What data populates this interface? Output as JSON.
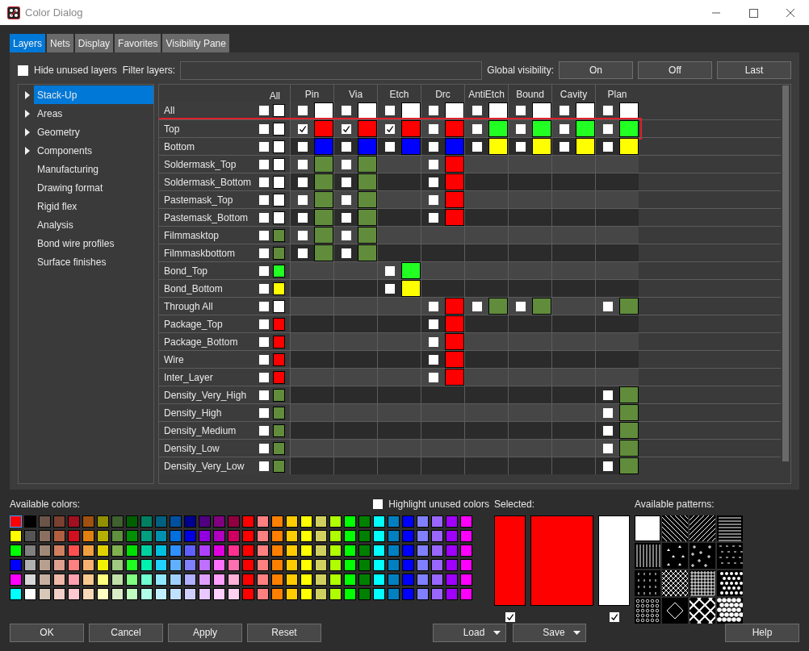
{
  "window": {
    "title": "Color Dialog"
  },
  "tabs": [
    {
      "label": "Layers",
      "selected": true
    },
    {
      "label": "Nets",
      "selected": false
    },
    {
      "label": "Display",
      "selected": false
    },
    {
      "label": "Favorites",
      "selected": false
    },
    {
      "label": "Visibility Pane",
      "selected": false
    }
  ],
  "filter_bar": {
    "hide_unused": {
      "label": "Hide unused layers",
      "checked": false
    },
    "filter_label": "Filter layers:",
    "global_label": "Global visibility:",
    "buttons": [
      "On",
      "Off",
      "Last"
    ]
  },
  "tree": [
    {
      "label": "Stack-Up",
      "kind": "group",
      "selected": true
    },
    {
      "label": "Areas",
      "kind": "group",
      "selected": false
    },
    {
      "label": "Geometry",
      "kind": "group",
      "selected": false
    },
    {
      "label": "Components",
      "kind": "group",
      "selected": false
    },
    {
      "label": "Manufacturing",
      "kind": "item",
      "selected": false
    },
    {
      "label": "Drawing format",
      "kind": "item",
      "selected": false
    },
    {
      "label": "Rigid flex",
      "kind": "item",
      "selected": false
    },
    {
      "label": "Analysis",
      "kind": "item",
      "selected": false
    },
    {
      "label": "Bond wire profiles",
      "kind": "item",
      "selected": false
    },
    {
      "label": "Surface finishes",
      "kind": "item",
      "selected": false
    }
  ],
  "table": {
    "columns": [
      "All",
      "Pin",
      "Via",
      "Etch",
      "Drc",
      "AntiEtch",
      "Bound",
      "Cavity",
      "Plan"
    ],
    "rows": [
      {
        "name": "All",
        "highlighted": false,
        "cells": [
          {
            "checked": false,
            "color": "#ffffff"
          },
          {
            "checked": false,
            "color": "#ffffff"
          },
          {
            "checked": false,
            "color": "#ffffff"
          },
          {
            "checked": false,
            "color": "#ffffff"
          },
          {
            "checked": false,
            "color": "#ffffff"
          },
          {
            "checked": false,
            "color": "#ffffff"
          },
          {
            "checked": false,
            "color": "#ffffff"
          },
          {
            "checked": false,
            "color": "#ffffff"
          },
          {
            "checked": false,
            "color": "#ffffff"
          }
        ]
      },
      {
        "name": "Top",
        "highlighted": true,
        "cells": [
          {
            "checked": false,
            "color": "#ffffff"
          },
          {
            "checked": true,
            "color": "#ff0000"
          },
          {
            "checked": true,
            "color": "#ff0000"
          },
          {
            "checked": true,
            "color": "#ff0000"
          },
          {
            "checked": false,
            "color": "#ff0000"
          },
          {
            "checked": false,
            "color": "#22ff22"
          },
          {
            "checked": false,
            "color": "#22ff22"
          },
          {
            "checked": false,
            "color": "#22ff22"
          },
          {
            "checked": false,
            "color": "#22ff22"
          }
        ]
      },
      {
        "name": "Bottom",
        "highlighted": false,
        "cells": [
          {
            "checked": false,
            "color": "#ffffff"
          },
          {
            "checked": false,
            "color": "#0000ff"
          },
          {
            "checked": false,
            "color": "#0000ff"
          },
          {
            "checked": false,
            "color": "#0000ff"
          },
          {
            "checked": false,
            "color": "#0000ff"
          },
          {
            "checked": false,
            "color": "#ffff00"
          },
          {
            "checked": false,
            "color": "#ffff00"
          },
          {
            "checked": false,
            "color": "#ffff00"
          },
          {
            "checked": false,
            "color": "#ffff00"
          }
        ]
      },
      {
        "name": "Soldermask_Top",
        "highlighted": false,
        "cells": [
          {
            "checked": false,
            "color": "#ffffff"
          },
          {
            "checked": false,
            "color": "#608c3c"
          },
          {
            "checked": false,
            "color": "#608c3c"
          },
          null,
          {
            "checked": false,
            "color": "#ff0000"
          },
          null,
          null,
          null,
          null
        ]
      },
      {
        "name": "Soldermask_Bottom",
        "highlighted": false,
        "cells": [
          {
            "checked": false,
            "color": "#ffffff"
          },
          {
            "checked": false,
            "color": "#608c3c"
          },
          {
            "checked": false,
            "color": "#608c3c"
          },
          null,
          {
            "checked": false,
            "color": "#ff0000"
          },
          null,
          null,
          null,
          null
        ]
      },
      {
        "name": "Pastemask_Top",
        "highlighted": false,
        "cells": [
          {
            "checked": false,
            "color": "#ffffff"
          },
          {
            "checked": false,
            "color": "#608c3c"
          },
          {
            "checked": false,
            "color": "#608c3c"
          },
          null,
          {
            "checked": false,
            "color": "#ff0000"
          },
          null,
          null,
          null,
          null
        ]
      },
      {
        "name": "Pastemask_Bottom",
        "highlighted": false,
        "cells": [
          {
            "checked": false,
            "color": "#ffffff"
          },
          {
            "checked": false,
            "color": "#608c3c"
          },
          {
            "checked": false,
            "color": "#608c3c"
          },
          null,
          {
            "checked": false,
            "color": "#ff0000"
          },
          null,
          null,
          null,
          null
        ]
      },
      {
        "name": "Filmmasktop",
        "highlighted": false,
        "cells": [
          {
            "checked": false,
            "color": "#608c3c"
          },
          {
            "checked": false,
            "color": "#608c3c"
          },
          {
            "checked": false,
            "color": "#608c3c"
          },
          null,
          null,
          null,
          null,
          null,
          null
        ]
      },
      {
        "name": "Filmmaskbottom",
        "highlighted": false,
        "cells": [
          {
            "checked": false,
            "color": "#608c3c"
          },
          {
            "checked": false,
            "color": "#608c3c"
          },
          {
            "checked": false,
            "color": "#608c3c"
          },
          null,
          null,
          null,
          null,
          null,
          null
        ]
      },
      {
        "name": "Bond_Top",
        "highlighted": false,
        "cells": [
          {
            "checked": false,
            "color": "#22ff22"
          },
          null,
          null,
          {
            "checked": false,
            "color": "#22ff22"
          },
          null,
          null,
          null,
          null,
          null
        ]
      },
      {
        "name": "Bond_Bottom",
        "highlighted": false,
        "cells": [
          {
            "checked": false,
            "color": "#ffff00"
          },
          null,
          null,
          {
            "checked": false,
            "color": "#ffff00"
          },
          null,
          null,
          null,
          null,
          null
        ]
      },
      {
        "name": "Through All",
        "highlighted": false,
        "cells": [
          {
            "checked": false,
            "color": "#ffffff"
          },
          null,
          null,
          null,
          {
            "checked": false,
            "color": "#ff0000"
          },
          {
            "checked": false,
            "color": "#608c3c"
          },
          {
            "checked": false,
            "color": "#608c3c"
          },
          null,
          {
            "checked": false,
            "color": "#608c3c"
          }
        ]
      },
      {
        "name": "Package_Top",
        "highlighted": false,
        "cells": [
          {
            "checked": false,
            "color": "#ff0000"
          },
          null,
          null,
          null,
          {
            "checked": false,
            "color": "#ff0000"
          },
          null,
          null,
          null,
          null
        ]
      },
      {
        "name": "Package_Bottom",
        "highlighted": false,
        "cells": [
          {
            "checked": false,
            "color": "#ff0000"
          },
          null,
          null,
          null,
          {
            "checked": false,
            "color": "#ff0000"
          },
          null,
          null,
          null,
          null
        ]
      },
      {
        "name": "Wire",
        "highlighted": false,
        "cells": [
          {
            "checked": false,
            "color": "#ff0000"
          },
          null,
          null,
          null,
          {
            "checked": false,
            "color": "#ff0000"
          },
          null,
          null,
          null,
          null
        ]
      },
      {
        "name": "Inter_Layer",
        "highlighted": false,
        "cells": [
          {
            "checked": false,
            "color": "#ff0000"
          },
          null,
          null,
          null,
          {
            "checked": false,
            "color": "#ff0000"
          },
          null,
          null,
          null,
          null
        ]
      },
      {
        "name": "Density_Very_High",
        "highlighted": false,
        "cells": [
          {
            "checked": false,
            "color": "#608c3c"
          },
          null,
          null,
          null,
          null,
          null,
          null,
          null,
          {
            "checked": false,
            "color": "#608c3c"
          }
        ]
      },
      {
        "name": "Density_High",
        "highlighted": false,
        "cells": [
          {
            "checked": false,
            "color": "#608c3c"
          },
          null,
          null,
          null,
          null,
          null,
          null,
          null,
          {
            "checked": false,
            "color": "#608c3c"
          }
        ]
      },
      {
        "name": "Density_Medium",
        "highlighted": false,
        "cells": [
          {
            "checked": false,
            "color": "#608c3c"
          },
          null,
          null,
          null,
          null,
          null,
          null,
          null,
          {
            "checked": false,
            "color": "#608c3c"
          }
        ]
      },
      {
        "name": "Density_Low",
        "highlighted": false,
        "cells": [
          {
            "checked": false,
            "color": "#608c3c"
          },
          null,
          null,
          null,
          null,
          null,
          null,
          null,
          {
            "checked": false,
            "color": "#608c3c"
          }
        ]
      },
      {
        "name": "Density_Very_Low",
        "highlighted": false,
        "cells": [
          {
            "checked": false,
            "color": "#608c3c"
          },
          null,
          null,
          null,
          null,
          null,
          null,
          null,
          {
            "checked": false,
            "color": "#608c3c"
          }
        ]
      }
    ]
  },
  "colors": {
    "label": "Available colors:",
    "highlight": {
      "label": "Highlight unused colors",
      "checked": false
    },
    "rows": [
      [
        {
          "color": "#ff0000",
          "selected": true
        },
        {
          "color": "#000000",
          "selected": false
        },
        {
          "color": "#6b5548",
          "selected": false
        },
        {
          "color": "#7a4030",
          "selected": false
        },
        {
          "color": "#a01020",
          "selected": false
        },
        {
          "color": "#a05010",
          "selected": false
        },
        {
          "color": "#909000",
          "selected": false
        },
        {
          "color": "#406030",
          "selected": false
        },
        {
          "color": "#006000",
          "selected": false
        },
        {
          "color": "#008060",
          "selected": false
        },
        {
          "color": "#006080",
          "selected": false
        },
        {
          "color": "#0050a0",
          "selected": false
        },
        {
          "color": "#000090",
          "selected": false
        },
        {
          "color": "#500080",
          "selected": false
        },
        {
          "color": "#800080",
          "selected": false
        },
        {
          "color": "#900040",
          "selected": false
        },
        {
          "color": "#ff0000",
          "selected": false
        },
        {
          "color": "#ff8080",
          "selected": false
        },
        {
          "color": "#ff8000",
          "selected": false
        },
        {
          "color": "#ffcc00",
          "selected": false
        },
        {
          "color": "#ffff00",
          "selected": false
        },
        {
          "color": "#d0d060",
          "selected": false
        },
        {
          "color": "#b0ff00",
          "selected": false
        },
        {
          "color": "#00ff00",
          "selected": false
        },
        {
          "color": "#008000",
          "selected": false
        },
        {
          "color": "#00ffff",
          "selected": false
        },
        {
          "color": "#0080c0",
          "selected": false
        },
        {
          "color": "#0000ff",
          "selected": false
        },
        {
          "color": "#8080ff",
          "selected": false
        },
        {
          "color": "#9966ff",
          "selected": false
        },
        {
          "color": "#a000ff",
          "selected": false
        },
        {
          "color": "#ff00ff",
          "selected": false
        }
      ],
      [
        {
          "color": "#ffff00",
          "selected": false
        },
        {
          "color": "#555555",
          "selected": false
        },
        {
          "color": "#8a7060",
          "selected": false
        },
        {
          "color": "#b06040",
          "selected": false
        },
        {
          "color": "#d01020",
          "selected": false
        },
        {
          "color": "#e08010",
          "selected": false
        },
        {
          "color": "#b8b000",
          "selected": false
        },
        {
          "color": "#609040",
          "selected": false
        },
        {
          "color": "#009000",
          "selected": false
        },
        {
          "color": "#00a080",
          "selected": false
        },
        {
          "color": "#0090b0",
          "selected": false
        },
        {
          "color": "#0070e0",
          "selected": false
        },
        {
          "color": "#0000e0",
          "selected": false
        },
        {
          "color": "#9000e0",
          "selected": false
        },
        {
          "color": "#b000c0",
          "selected": false
        },
        {
          "color": "#d00060",
          "selected": false
        },
        {
          "color": "#ff0000",
          "selected": false
        },
        {
          "color": "#ff8080",
          "selected": false
        },
        {
          "color": "#ff8000",
          "selected": false
        },
        {
          "color": "#ffcc00",
          "selected": false
        },
        {
          "color": "#ffff00",
          "selected": false
        },
        {
          "color": "#d0d060",
          "selected": false
        },
        {
          "color": "#b0ff00",
          "selected": false
        },
        {
          "color": "#00ff00",
          "selected": false
        },
        {
          "color": "#008000",
          "selected": false
        },
        {
          "color": "#00ffff",
          "selected": false
        },
        {
          "color": "#0080c0",
          "selected": false
        },
        {
          "color": "#0000ff",
          "selected": false
        },
        {
          "color": "#8080ff",
          "selected": false
        },
        {
          "color": "#9966ff",
          "selected": false
        },
        {
          "color": "#a000ff",
          "selected": false
        },
        {
          "color": "#ff00ff",
          "selected": false
        }
      ],
      [
        {
          "color": "#00ff00",
          "selected": false
        },
        {
          "color": "#808080",
          "selected": false
        },
        {
          "color": "#a08878",
          "selected": false
        },
        {
          "color": "#d08060",
          "selected": false
        },
        {
          "color": "#ff5050",
          "selected": false
        },
        {
          "color": "#f0a040",
          "selected": false
        },
        {
          "color": "#e0d000",
          "selected": false
        },
        {
          "color": "#80b050",
          "selected": false
        },
        {
          "color": "#00e000",
          "selected": false
        },
        {
          "color": "#00d0a0",
          "selected": false
        },
        {
          "color": "#00c0e0",
          "selected": false
        },
        {
          "color": "#3090ff",
          "selected": false
        },
        {
          "color": "#6060ff",
          "selected": false
        },
        {
          "color": "#b040ff",
          "selected": false
        },
        {
          "color": "#e000e0",
          "selected": false
        },
        {
          "color": "#ff3090",
          "selected": false
        },
        {
          "color": "#ff0000",
          "selected": false
        },
        {
          "color": "#ff8080",
          "selected": false
        },
        {
          "color": "#ff8000",
          "selected": false
        },
        {
          "color": "#ffcc00",
          "selected": false
        },
        {
          "color": "#ffff00",
          "selected": false
        },
        {
          "color": "#d0d060",
          "selected": false
        },
        {
          "color": "#b0ff00",
          "selected": false
        },
        {
          "color": "#00ff00",
          "selected": false
        },
        {
          "color": "#008000",
          "selected": false
        },
        {
          "color": "#00ffff",
          "selected": false
        },
        {
          "color": "#0080c0",
          "selected": false
        },
        {
          "color": "#0000ff",
          "selected": false
        },
        {
          "color": "#8080ff",
          "selected": false
        },
        {
          "color": "#9966ff",
          "selected": false
        },
        {
          "color": "#a000ff",
          "selected": false
        },
        {
          "color": "#ff00ff",
          "selected": false
        }
      ],
      [
        {
          "color": "#0000ff",
          "selected": false
        },
        {
          "color": "#b0b0b0",
          "selected": false
        },
        {
          "color": "#b8a090",
          "selected": false
        },
        {
          "color": "#e0a090",
          "selected": false
        },
        {
          "color": "#ff8080",
          "selected": false
        },
        {
          "color": "#f8b070",
          "selected": false
        },
        {
          "color": "#f0f000",
          "selected": false
        },
        {
          "color": "#a0c880",
          "selected": false
        },
        {
          "color": "#20ff20",
          "selected": false
        },
        {
          "color": "#00f0b0",
          "selected": false
        },
        {
          "color": "#20d0ff",
          "selected": false
        },
        {
          "color": "#60b0ff",
          "selected": false
        },
        {
          "color": "#8080ff",
          "selected": false
        },
        {
          "color": "#c070ff",
          "selected": false
        },
        {
          "color": "#ff70ff",
          "selected": false
        },
        {
          "color": "#ff70b0",
          "selected": false
        },
        {
          "color": "#ff0000",
          "selected": false
        },
        {
          "color": "#ff8080",
          "selected": false
        },
        {
          "color": "#ff8000",
          "selected": false
        },
        {
          "color": "#ffcc00",
          "selected": false
        },
        {
          "color": "#ffff00",
          "selected": false
        },
        {
          "color": "#d0d060",
          "selected": false
        },
        {
          "color": "#b0ff00",
          "selected": false
        },
        {
          "color": "#00ff00",
          "selected": false
        },
        {
          "color": "#008000",
          "selected": false
        },
        {
          "color": "#00ffff",
          "selected": false
        },
        {
          "color": "#0080c0",
          "selected": false
        },
        {
          "color": "#0000ff",
          "selected": false
        },
        {
          "color": "#8080ff",
          "selected": false
        },
        {
          "color": "#9966ff",
          "selected": false
        },
        {
          "color": "#a000ff",
          "selected": false
        },
        {
          "color": "#ff00ff",
          "selected": false
        }
      ],
      [
        {
          "color": "#ff00ff",
          "selected": false
        },
        {
          "color": "#d8d8d8",
          "selected": false
        },
        {
          "color": "#c8b0a0",
          "selected": false
        },
        {
          "color": "#f0b8a8",
          "selected": false
        },
        {
          "color": "#ffa0b0",
          "selected": false
        },
        {
          "color": "#f8c890",
          "selected": false
        },
        {
          "color": "#ffff80",
          "selected": false
        },
        {
          "color": "#c0e0a8",
          "selected": false
        },
        {
          "color": "#80ff80",
          "selected": false
        },
        {
          "color": "#70ffd0",
          "selected": false
        },
        {
          "color": "#90e8ff",
          "selected": false
        },
        {
          "color": "#a0d0ff",
          "selected": false
        },
        {
          "color": "#b0b0ff",
          "selected": false
        },
        {
          "color": "#e0a0ff",
          "selected": false
        },
        {
          "color": "#ffa0ff",
          "selected": false
        },
        {
          "color": "#ffb0d8",
          "selected": false
        },
        {
          "color": "#ff0000",
          "selected": false
        },
        {
          "color": "#ff8080",
          "selected": false
        },
        {
          "color": "#ff8000",
          "selected": false
        },
        {
          "color": "#ffcc00",
          "selected": false
        },
        {
          "color": "#ffff00",
          "selected": false
        },
        {
          "color": "#d0d060",
          "selected": false
        },
        {
          "color": "#b0ff00",
          "selected": false
        },
        {
          "color": "#00ff00",
          "selected": false
        },
        {
          "color": "#008000",
          "selected": false
        },
        {
          "color": "#00ffff",
          "selected": false
        },
        {
          "color": "#0080c0",
          "selected": false
        },
        {
          "color": "#0000ff",
          "selected": false
        },
        {
          "color": "#8080ff",
          "selected": false
        },
        {
          "color": "#9966ff",
          "selected": false
        },
        {
          "color": "#a000ff",
          "selected": false
        },
        {
          "color": "#ff00ff",
          "selected": false
        }
      ],
      [
        {
          "color": "#00ffff",
          "selected": false
        },
        {
          "color": "#ffffff",
          "selected": false
        },
        {
          "color": "#d8c8b8",
          "selected": false
        },
        {
          "color": "#f0d0c8",
          "selected": false
        },
        {
          "color": "#ffc8d0",
          "selected": false
        },
        {
          "color": "#f8d8b8",
          "selected": false
        },
        {
          "color": "#ffffc0",
          "selected": false
        },
        {
          "color": "#d8ecc8",
          "selected": false
        },
        {
          "color": "#c0ffc0",
          "selected": false
        },
        {
          "color": "#b0ffe8",
          "selected": false
        },
        {
          "color": "#c0f0ff",
          "selected": false
        },
        {
          "color": "#c0e0ff",
          "selected": false
        },
        {
          "color": "#d0d0ff",
          "selected": false
        },
        {
          "color": "#e8c8ff",
          "selected": false
        },
        {
          "color": "#ffd0ff",
          "selected": false
        },
        {
          "color": "#ffd0f0",
          "selected": false
        },
        {
          "color": "#ff0000",
          "selected": false
        },
        {
          "color": "#ff8080",
          "selected": false
        },
        {
          "color": "#ff8000",
          "selected": false
        },
        {
          "color": "#ffcc00",
          "selected": false
        },
        {
          "color": "#ffff00",
          "selected": false
        },
        {
          "color": "#d0d060",
          "selected": false
        },
        {
          "color": "#b0ff00",
          "selected": false
        },
        {
          "color": "#00ff00",
          "selected": false
        },
        {
          "color": "#008000",
          "selected": false
        },
        {
          "color": "#00ffff",
          "selected": false
        },
        {
          "color": "#0080c0",
          "selected": false
        },
        {
          "color": "#0000ff",
          "selected": false
        },
        {
          "color": "#8080ff",
          "selected": false
        },
        {
          "color": "#9966ff",
          "selected": false
        },
        {
          "color": "#a000ff",
          "selected": false
        },
        {
          "color": "#ff00ff",
          "selected": false
        }
      ]
    ]
  },
  "selected": {
    "label": "Selected:",
    "swatches": [
      {
        "color": "#ff0000",
        "checked": true
      },
      {
        "color": "#ff0000"
      },
      {
        "color": "#ffffff",
        "checked": true
      }
    ]
  },
  "patterns": {
    "label": "Available patterns:",
    "tiles": [
      {
        "kind": "solid"
      },
      {
        "kind": "diag-down"
      },
      {
        "kind": "diag-up"
      },
      {
        "kind": "horizontal"
      },
      {
        "kind": "vertical"
      },
      {
        "kind": "triangles"
      },
      {
        "kind": "plus"
      },
      {
        "kind": "dashes"
      },
      {
        "kind": "ticks"
      },
      {
        "kind": "crosshatch"
      },
      {
        "kind": "grid"
      },
      {
        "kind": "dots"
      },
      {
        "kind": "rings"
      },
      {
        "kind": "diamond"
      },
      {
        "kind": "lattice"
      },
      {
        "kind": "big-dots"
      }
    ]
  },
  "actions": [
    "OK",
    "Cancel",
    "Apply",
    "Reset"
  ],
  "file_buttons": [
    {
      "label": "Load",
      "kind": "menu"
    },
    {
      "label": "Save",
      "kind": "menu"
    }
  ],
  "help_button": "Help"
}
